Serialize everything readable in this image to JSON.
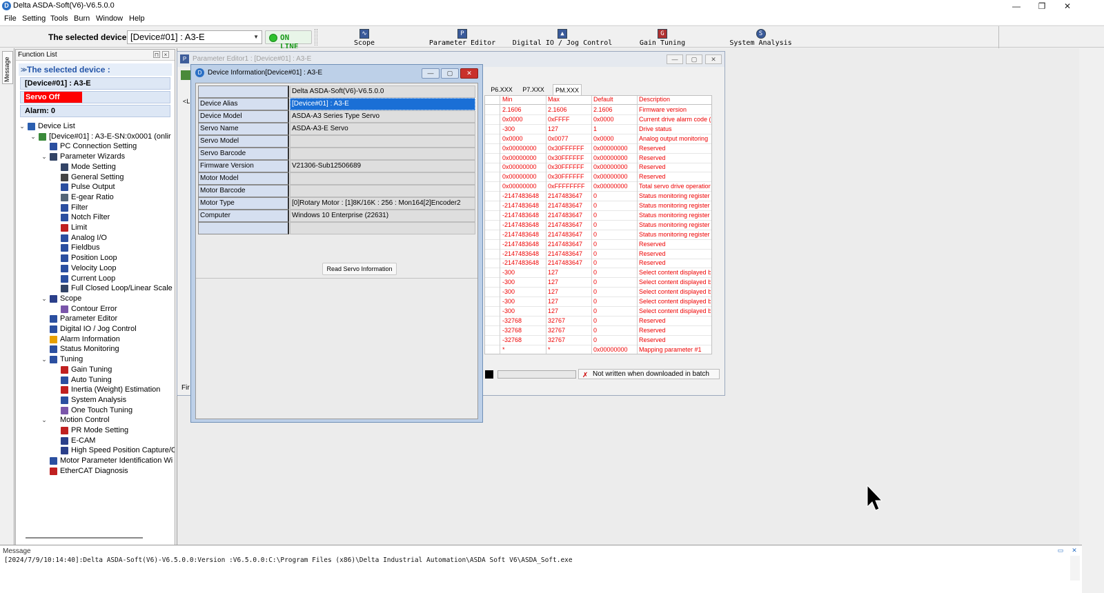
{
  "window": {
    "title": "Delta ASDA-Soft(V6)-V6.5.0.0",
    "controls": {
      "minimize": "—",
      "maximize": "❐",
      "close": "✕"
    }
  },
  "menu": [
    "File",
    "Setting",
    "Tools",
    "Burn",
    "Window",
    "Help"
  ],
  "toolbar": {
    "device_label": "The selected device :",
    "device_value": "[Device#01]  : A3-E",
    "online_label": "ON LINE",
    "tools": [
      "Scope",
      "Parameter Editor",
      "Digital IO / Jog Control",
      "Gain Tuning",
      "System Analysis"
    ]
  },
  "side_tab": "Message",
  "function_list": {
    "title": "Function List",
    "selected_header": "The selected device :",
    "device": "[Device#01]  : A3-E",
    "servo_status": "Servo Off",
    "alarm": "Alarm: 0",
    "tree": [
      {
        "label": "Device List",
        "indent": 0,
        "toggle": "v",
        "color": "#2b5fb0"
      },
      {
        "label": "[Device#01]  : A3-E-SN:0x0001 (onlir",
        "indent": 1,
        "toggle": "v",
        "color": "#3a8a3a"
      },
      {
        "label": "PC Connection Setting",
        "indent": 2,
        "toggle": "",
        "color": "#2b4fa0"
      },
      {
        "label": "Parameter Wizards",
        "indent": 2,
        "toggle": "v",
        "color": "#334466"
      },
      {
        "label": "Mode Setting",
        "indent": 3,
        "toggle": "",
        "color": "#334466"
      },
      {
        "label": "General Setting",
        "indent": 3,
        "toggle": "",
        "color": "#444444"
      },
      {
        "label": "Pulse Output",
        "indent": 3,
        "toggle": "",
        "color": "#2b4fa0"
      },
      {
        "label": "E-gear Ratio",
        "indent": 3,
        "toggle": "",
        "color": "#556677"
      },
      {
        "label": "Filter",
        "indent": 3,
        "toggle": "",
        "color": "#2b4fa0"
      },
      {
        "label": "Notch Filter",
        "indent": 3,
        "toggle": "",
        "color": "#2b4fa0"
      },
      {
        "label": "Limit",
        "indent": 3,
        "toggle": "",
        "color": "#c02020"
      },
      {
        "label": "Analog I/O",
        "indent": 3,
        "toggle": "",
        "color": "#2b4fa0"
      },
      {
        "label": "Fieldbus",
        "indent": 3,
        "toggle": "",
        "color": "#2b4fa0"
      },
      {
        "label": "Position Loop",
        "indent": 3,
        "toggle": "",
        "color": "#2b4fa0"
      },
      {
        "label": "Velocity Loop",
        "indent": 3,
        "toggle": "",
        "color": "#2b4fa0"
      },
      {
        "label": "Current Loop",
        "indent": 3,
        "toggle": "",
        "color": "#2b4fa0"
      },
      {
        "label": "Full Closed Loop/Linear Scale",
        "indent": 3,
        "toggle": "",
        "color": "#334466"
      },
      {
        "label": "Scope",
        "indent": 2,
        "toggle": "v",
        "color": "#2b3f8a"
      },
      {
        "label": "Contour Error",
        "indent": 3,
        "toggle": "",
        "color": "#7a55aa"
      },
      {
        "label": "Parameter Editor",
        "indent": 2,
        "toggle": "",
        "color": "#2b4fa0"
      },
      {
        "label": "Digital IO / Jog Control",
        "indent": 2,
        "toggle": "",
        "color": "#2b4fa0"
      },
      {
        "label": "Alarm Information",
        "indent": 2,
        "toggle": "",
        "color": "#e8a000"
      },
      {
        "label": "Status Monitoring",
        "indent": 2,
        "toggle": "",
        "color": "#2b4fa0"
      },
      {
        "label": "Tuning",
        "indent": 2,
        "toggle": "v",
        "color": "#2b4fa0"
      },
      {
        "label": "Gain Tuning",
        "indent": 3,
        "toggle": "",
        "color": "#c02020"
      },
      {
        "label": "Auto Tuning",
        "indent": 3,
        "toggle": "",
        "color": "#2b4fa0"
      },
      {
        "label": "Inertia (Weight) Estimation",
        "indent": 3,
        "toggle": "",
        "color": "#c02020"
      },
      {
        "label": "System Analysis",
        "indent": 3,
        "toggle": "",
        "color": "#2b4fa0"
      },
      {
        "label": "One Touch Tuning",
        "indent": 3,
        "toggle": "",
        "color": "#7a55aa"
      },
      {
        "label": "Motion Control",
        "indent": 2,
        "toggle": "v",
        "color": ""
      },
      {
        "label": "PR Mode Setting",
        "indent": 3,
        "toggle": "",
        "color": "#c02020"
      },
      {
        "label": "E-CAM",
        "indent": 3,
        "toggle": "",
        "color": "#2b3f8a"
      },
      {
        "label": "High Speed Position Capture/C",
        "indent": 3,
        "toggle": "",
        "color": "#2b3f8a"
      },
      {
        "label": "Motor Parameter Identification Wi",
        "indent": 2,
        "toggle": "",
        "color": "#2b4fa0"
      },
      {
        "label": "EtherCAT Diagnosis",
        "indent": 2,
        "toggle": "",
        "color": "#c02020"
      }
    ]
  },
  "param_editor": {
    "title": "Parameter Editor1 : [Device#01]  : A3-E",
    "tabs": [
      "P6.XXX",
      "P7.XXX",
      "PM.XXX"
    ],
    "columns": [
      "Min",
      "Max",
      "Default",
      "Description"
    ],
    "rows": [
      [
        "2.1606",
        "2.1606",
        "2.1606",
        "Firmware version"
      ],
      [
        "0x0000",
        "0xFFFF",
        "0x0000",
        "Current drive alarm code (:"
      ],
      [
        "-300",
        "127",
        "1",
        "Drive status"
      ],
      [
        "0x0000",
        "0x0077",
        "0x0000",
        "Analog output monitoring"
      ],
      [
        "0x00000000",
        "0x30FFFFFF",
        "0x00000000",
        "Reserved"
      ],
      [
        "0x00000000",
        "0x30FFFFFF",
        "0x00000000",
        "Reserved"
      ],
      [
        "0x00000000",
        "0x30FFFFFF",
        "0x00000000",
        "Reserved"
      ],
      [
        "0x00000000",
        "0x30FFFFFF",
        "0x00000000",
        "Reserved"
      ],
      [
        "0x00000000",
        "0xFFFFFFFF",
        "0x00000000",
        "Total servo drive operation"
      ],
      [
        "-2147483648",
        "2147483647",
        "0",
        "Status monitoring register"
      ],
      [
        "-2147483648",
        "2147483647",
        "0",
        "Status monitoring register"
      ],
      [
        "-2147483648",
        "2147483647",
        "0",
        "Status monitoring register"
      ],
      [
        "-2147483648",
        "2147483647",
        "0",
        "Status monitoring register"
      ],
      [
        "-2147483648",
        "2147483647",
        "0",
        "Status monitoring register"
      ],
      [
        "-2147483648",
        "2147483647",
        "0",
        "Reserved"
      ],
      [
        "-2147483648",
        "2147483647",
        "0",
        "Reserved"
      ],
      [
        "-2147483648",
        "2147483647",
        "0",
        "Reserved"
      ],
      [
        "-300",
        "127",
        "0",
        "Select content displayed by"
      ],
      [
        "-300",
        "127",
        "0",
        "Select content displayed by"
      ],
      [
        "-300",
        "127",
        "0",
        "Select content displayed by"
      ],
      [
        "-300",
        "127",
        "0",
        "Select content displayed by"
      ],
      [
        "-300",
        "127",
        "0",
        "Select content displayed by"
      ],
      [
        "-32768",
        "32767",
        "0",
        "Reserved"
      ],
      [
        "-32768",
        "32767",
        "0",
        "Reserved"
      ],
      [
        "-32768",
        "32767",
        "0",
        "Reserved"
      ],
      [
        "*",
        "*",
        "0x00000000",
        "Mapping parameter #1"
      ]
    ],
    "left_fragments": [
      "<L",
      "Fir"
    ],
    "status_note": "Not written when downloaded in batch"
  },
  "device_info": {
    "title": "Device Information[Device#01]  : A3-E",
    "rows": [
      [
        "",
        "Delta ASDA-Soft(V6)-V6.5.0.0"
      ],
      [
        "Device Alias",
        "[Device#01]  : A3-E"
      ],
      [
        "Device Model",
        "ASDA-A3 Series Type Servo"
      ],
      [
        "Servo Name",
        "ASDA-A3-E Servo"
      ],
      [
        "Servo Model",
        ""
      ],
      [
        "Servo Barcode",
        ""
      ],
      [
        "Firmware Version",
        "V21306-Sub12506689"
      ],
      [
        "Motor Model",
        ""
      ],
      [
        "Motor Barcode",
        ""
      ],
      [
        "Motor Type",
        "[0]Rotary Motor : [1]8K/16K : 256 : Mon164[2]Encoder2"
      ],
      [
        "Computer",
        "Windows 10 Enterprise  (22631)"
      ],
      [
        "",
        ""
      ]
    ],
    "read_button": "Read Servo Information"
  },
  "message": {
    "header": "Message",
    "line": "[2024/7/9/10:14:40]:Delta ASDA-Soft(V6)-V6.5.0.0:Version :V6.5.0.0:C:\\Program Files (x86)\\Delta Industrial Automation\\ASDA Soft V6\\ASDA_Soft.exe"
  }
}
